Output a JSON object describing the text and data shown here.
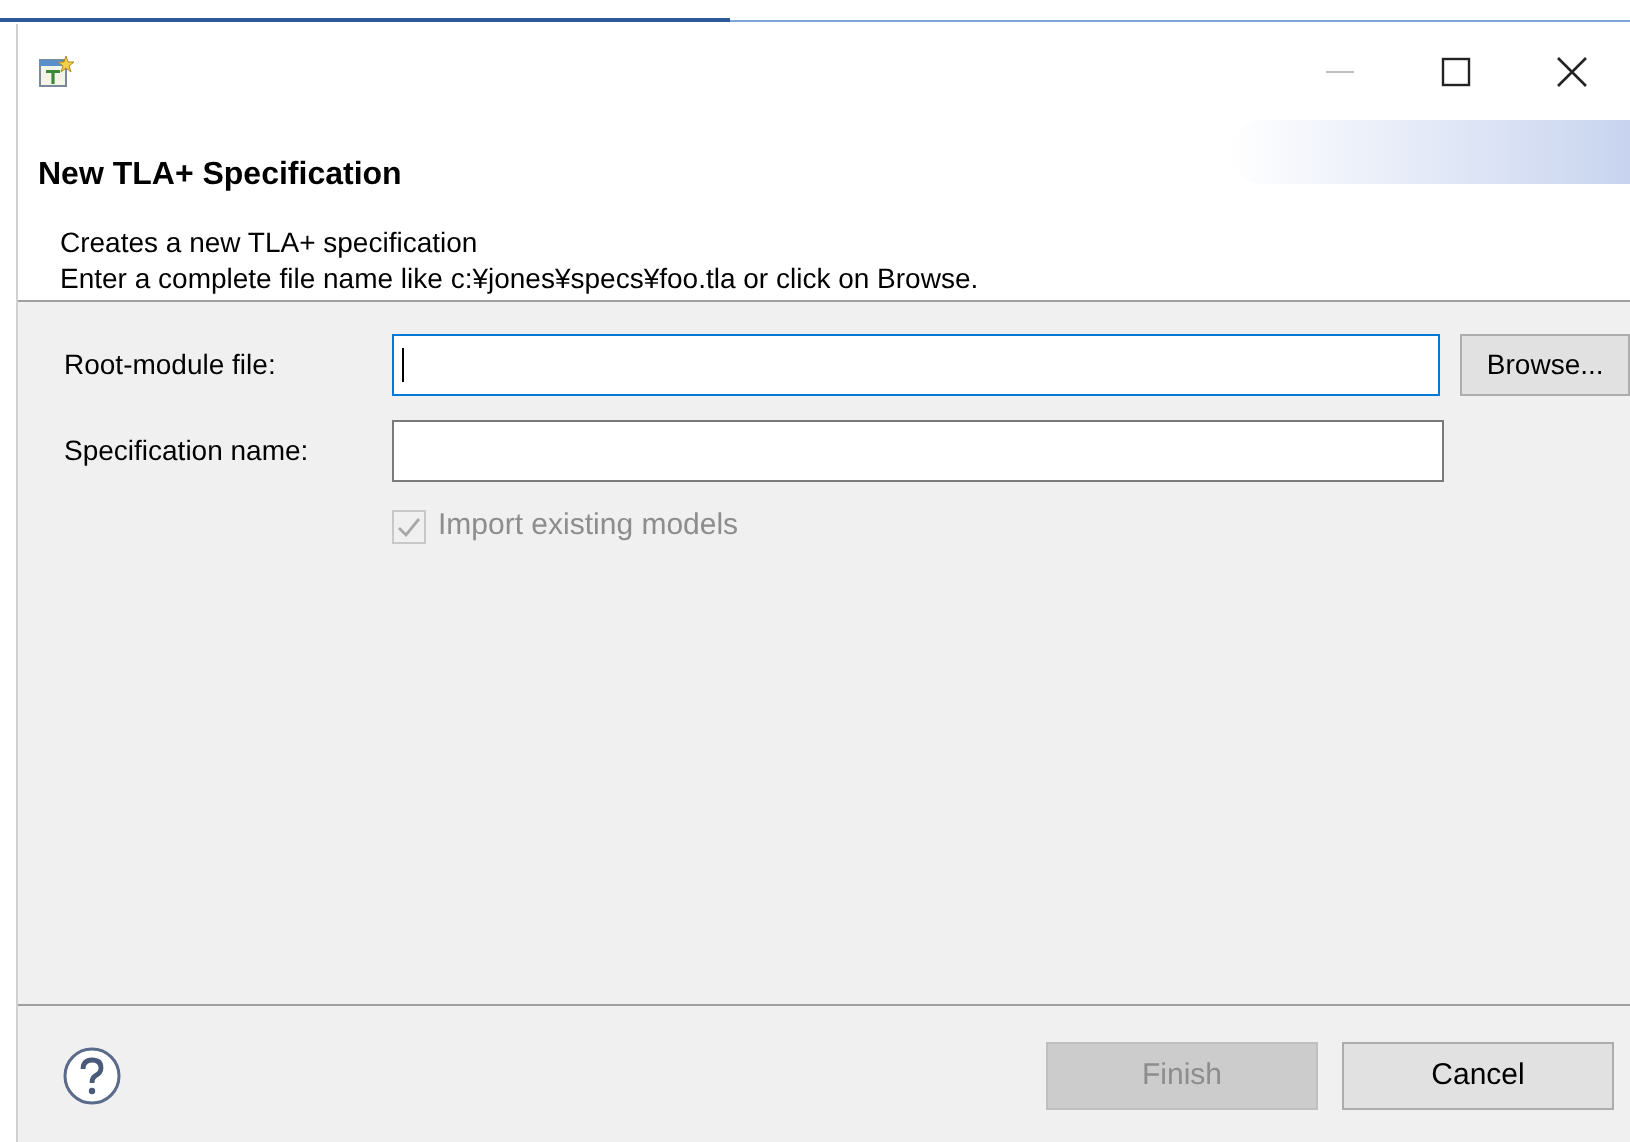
{
  "header": {
    "title": "New TLA+ Specification",
    "description": [
      "Creates a new TLA+ specification",
      "Enter a complete file name like c:¥jones¥specs¥foo.tla or click on Browse."
    ]
  },
  "fields": [
    {
      "label": "Root-module file:",
      "focused": true,
      "button": "Browse..."
    },
    {
      "label": "Specification name:",
      "focused": false
    }
  ],
  "checkbox": {
    "label": "Import existing models",
    "checked": true,
    "disabled": true
  },
  "buttons": [
    {
      "label": "Finish",
      "disabled": true
    },
    {
      "label": "Cancel",
      "disabled": false
    }
  ]
}
